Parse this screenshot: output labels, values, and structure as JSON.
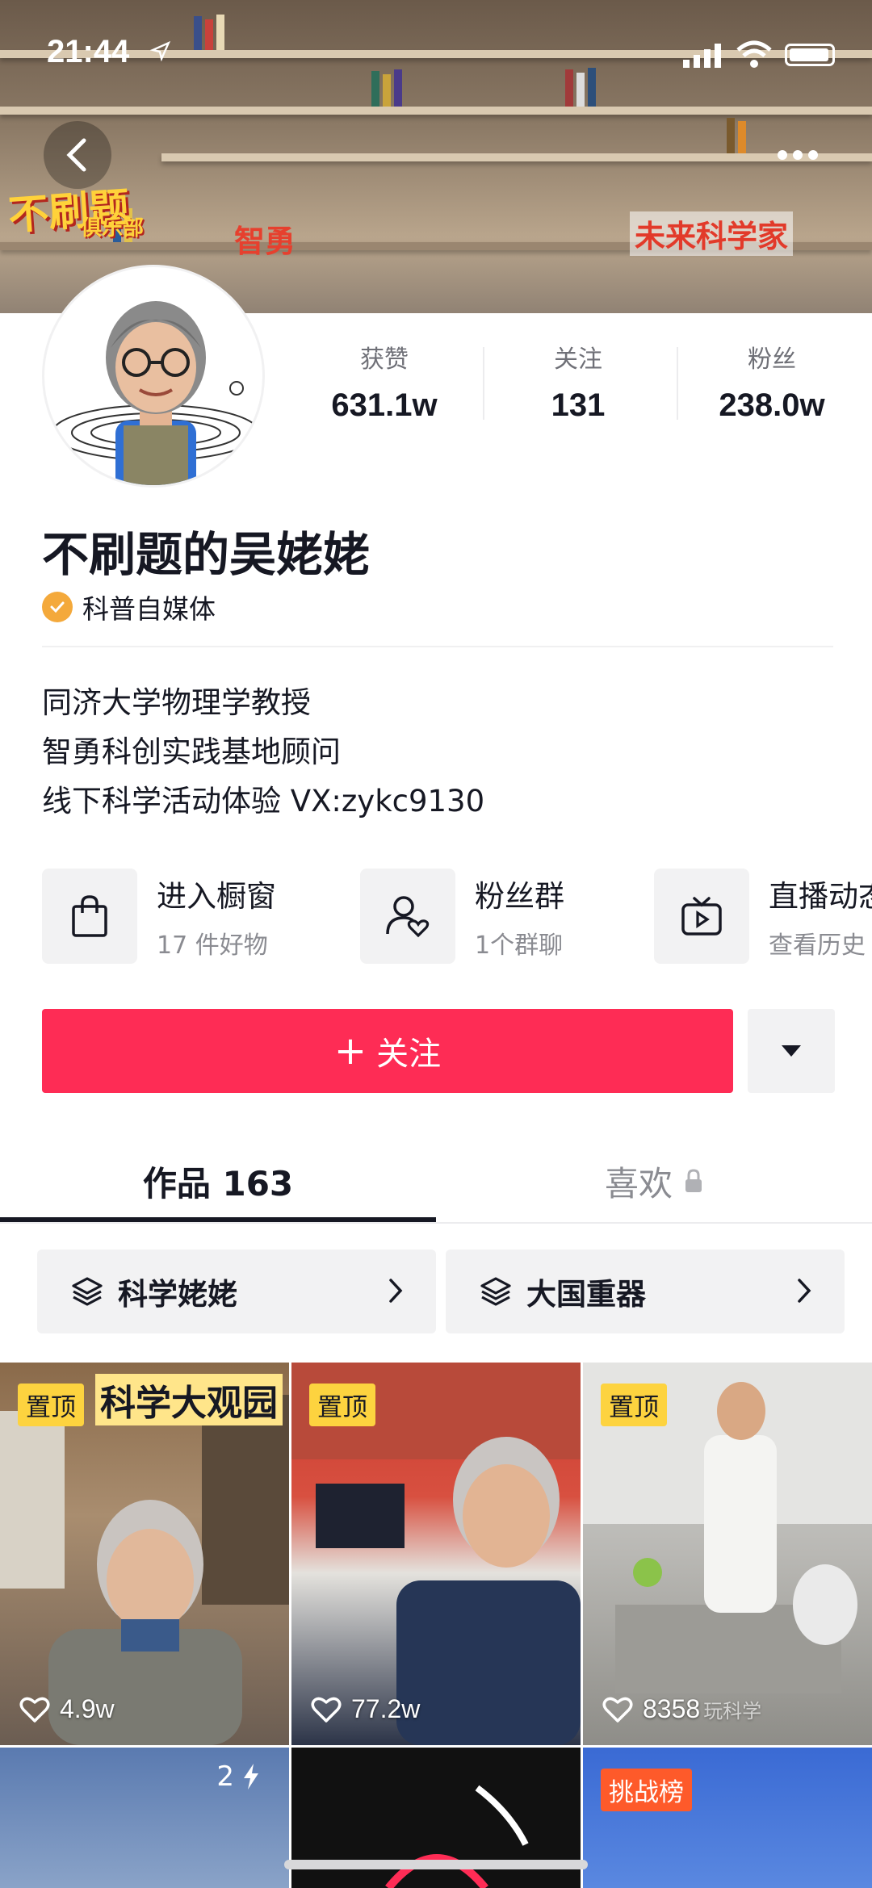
{
  "status_bar": {
    "time": "21:44"
  },
  "banner": {
    "title": "不刷题",
    "subtitle": "俱乐部",
    "brand": "智勇",
    "future": "未来科学家"
  },
  "profile": {
    "nickname": "不刷题的吴姥姥",
    "verification": "科普自媒体",
    "stats": [
      {
        "label": "获赞",
        "value": "631.1w"
      },
      {
        "label": "关注",
        "value": "131"
      },
      {
        "label": "粉丝",
        "value": "238.0w"
      }
    ],
    "bio": [
      "同济大学物理学教授",
      "智勇科创实践基地顾问",
      "线下科学活动体验 VX:zykc9130"
    ]
  },
  "shortcuts": [
    {
      "title": "进入橱窗",
      "sub": "17 件好物",
      "icon": "shopping-bag-icon"
    },
    {
      "title": "粉丝群",
      "sub": "1个群聊",
      "icon": "fan-group-icon"
    },
    {
      "title": "直播动态",
      "sub": "查看历史",
      "icon": "live-tv-icon"
    }
  ],
  "actions": {
    "follow_label": "关注"
  },
  "tabs": {
    "works": "作品 163",
    "likes": "喜欢"
  },
  "collections": [
    {
      "label": "科学姥姥"
    },
    {
      "label": "大国重器"
    }
  ],
  "videos": [
    {
      "badge": "置顶",
      "likes": "4.9w",
      "overlay_title": "科学大观园"
    },
    {
      "badge": "置顶",
      "likes": "77.2w"
    },
    {
      "badge": "置顶",
      "likes": "8358",
      "overlay_caption": "玩科学"
    },
    {
      "count": "2"
    },
    {},
    {
      "badge": "挑战榜"
    }
  ],
  "colors": {
    "accent": "#fe2c55",
    "pin_badge": "#fdd33f",
    "challenge_badge": "#fe5a2a",
    "verify": "#f4a93b"
  }
}
